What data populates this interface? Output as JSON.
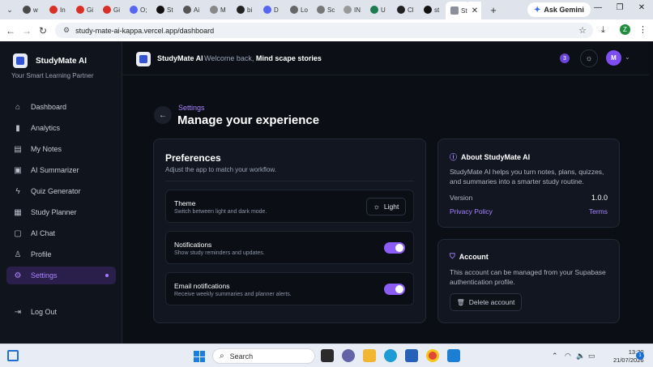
{
  "browser": {
    "tabs": [
      {
        "label": "w",
        "color": "#4a4a4a"
      },
      {
        "label": "In",
        "color": "#d93025"
      },
      {
        "label": "Gi",
        "color": "#d93025"
      },
      {
        "label": "Gi",
        "color": "#d93025"
      },
      {
        "label": "O;",
        "color": "#5865f2"
      },
      {
        "label": "St",
        "color": "#111111"
      },
      {
        "label": "Ai",
        "color": "#555555"
      },
      {
        "label": "M",
        "color": "#888888"
      },
      {
        "label": "bi",
        "color": "#222222"
      },
      {
        "label": "D",
        "color": "#5865f2"
      },
      {
        "label": "Lo",
        "color": "#666666"
      },
      {
        "label": "Sc",
        "color": "#777777"
      },
      {
        "label": "IN",
        "color": "#999999"
      },
      {
        "label": "U",
        "color": "#1e7d4f"
      },
      {
        "label": "Cl",
        "color": "#222222"
      },
      {
        "label": "st",
        "color": "#111111"
      }
    ],
    "active_tab": {
      "label": "St"
    },
    "ask_gemini": "Ask Gemini",
    "url": "study-mate-ai-kappa.vercel.app/dashboard",
    "profile_initial": "Z"
  },
  "sidebar": {
    "brand": "StudyMate AI",
    "tagline": "Your Smart Learning Partner",
    "items": [
      {
        "label": "Dashboard",
        "icon": "home-icon"
      },
      {
        "label": "Analytics",
        "icon": "bar-chart-icon"
      },
      {
        "label": "My Notes",
        "icon": "notes-icon"
      },
      {
        "label": "AI Summarizer",
        "icon": "cpu-icon"
      },
      {
        "label": "Quiz Generator",
        "icon": "bolt-icon"
      },
      {
        "label": "Study Planner",
        "icon": "calendar-icon"
      },
      {
        "label": "AI Chat",
        "icon": "chat-icon"
      },
      {
        "label": "Profile",
        "icon": "user-icon"
      },
      {
        "label": "Settings",
        "icon": "gear-icon",
        "active": true
      }
    ],
    "logout": "Log Out"
  },
  "header": {
    "title": "StudyMate AI",
    "welcome": "Welcome back,",
    "user_name": "Mind scape stories",
    "notification_count": "3",
    "avatar_initial": "M"
  },
  "page": {
    "breadcrumb": "Settings",
    "title": "Manage your experience"
  },
  "preferences": {
    "title": "Preferences",
    "subtitle": "Adjust the app to match your workflow.",
    "theme": {
      "label": "Theme",
      "desc": "Switch between light and dark mode.",
      "button": "Light"
    },
    "notifications": {
      "label": "Notifications",
      "desc": "Show study reminders and updates.",
      "enabled": true
    },
    "email": {
      "label": "Email notifications",
      "desc": "Receive weekly summaries and planner alerts.",
      "enabled": true
    }
  },
  "about": {
    "title": "About StudyMate AI",
    "text": "StudyMate AI helps you turn notes, plans, quizzes, and summaries into a smarter study routine.",
    "version_label": "Version",
    "version_value": "1.0.0",
    "privacy": "Privacy Policy",
    "terms": "Terms"
  },
  "account": {
    "title": "Account",
    "text": "This account can be managed from your Supabase authentication profile.",
    "delete_button": "Delete account"
  },
  "taskbar": {
    "search_placeholder": "Search",
    "time": "13:20",
    "date": "21/07/2026",
    "notif_count": "1"
  },
  "colors": {
    "accent": "#a983ff",
    "toggle_on": "#8b5cf6",
    "background": "#0b0e14"
  }
}
